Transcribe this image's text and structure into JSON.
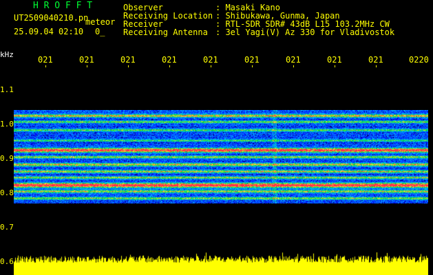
{
  "header": {
    "app_name": "H R O F F T",
    "file_name": "UT2509040210.pn",
    "mode_label": "meteor",
    "datetime": "25.09.04 02:10",
    "counter": "0_"
  },
  "info": {
    "labels": {
      "observer": "Observer",
      "location": "Receiving Location",
      "receiver": "Receiver",
      "antenna": "Receiving Antenna"
    },
    "values": {
      "observer": ": Masaki Kano",
      "location": ": Shibukawa, Gunma, Japan",
      "receiver": ": RTL-SDR SDR# 43dB L15 103.2MHz CW",
      "antenna": ": 3el Yagi(V) Az 330 for Vladivostok"
    }
  },
  "axis": {
    "unit": "kHz",
    "freq_ticks": [
      "1.1",
      "1.0",
      "0.9",
      "0.8",
      "0.7",
      "0.6"
    ],
    "time_ticks": [
      "021",
      "021",
      "021",
      "021",
      "021",
      "021",
      "021",
      "021",
      "021",
      "0220"
    ]
  },
  "colors": {
    "background": "#000000",
    "label": "#ffff00",
    "title": "#00ff33",
    "amplitude": "#ffff00"
  }
}
